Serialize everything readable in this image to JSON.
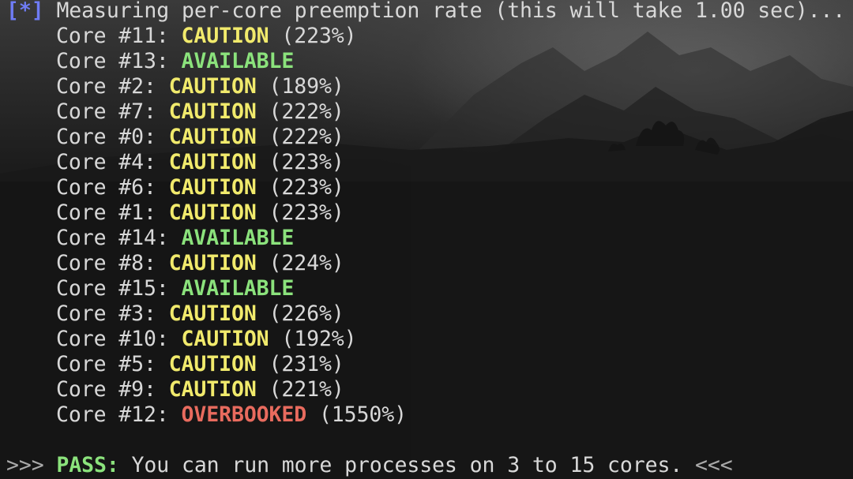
{
  "header": {
    "marker": "[*]",
    "message": "Measuring per-core preemption rate (this will take 1.00 sec)..."
  },
  "cores": [
    {
      "label": "Core #11: ",
      "status": "CAUTION",
      "rate": " (223%)",
      "kind": "caution"
    },
    {
      "label": "Core #13: ",
      "status": "AVAILABLE",
      "rate": "",
      "kind": "available"
    },
    {
      "label": "Core #2: ",
      "status": "CAUTION",
      "rate": " (189%)",
      "kind": "caution"
    },
    {
      "label": "Core #7: ",
      "status": "CAUTION",
      "rate": " (222%)",
      "kind": "caution"
    },
    {
      "label": "Core #0: ",
      "status": "CAUTION",
      "rate": " (222%)",
      "kind": "caution"
    },
    {
      "label": "Core #4: ",
      "status": "CAUTION",
      "rate": " (223%)",
      "kind": "caution"
    },
    {
      "label": "Core #6: ",
      "status": "CAUTION",
      "rate": " (223%)",
      "kind": "caution"
    },
    {
      "label": "Core #1: ",
      "status": "CAUTION",
      "rate": " (223%)",
      "kind": "caution"
    },
    {
      "label": "Core #14: ",
      "status": "AVAILABLE",
      "rate": "",
      "kind": "available"
    },
    {
      "label": "Core #8: ",
      "status": "CAUTION",
      "rate": " (224%)",
      "kind": "caution"
    },
    {
      "label": "Core #15: ",
      "status": "AVAILABLE",
      "rate": "",
      "kind": "available"
    },
    {
      "label": "Core #3: ",
      "status": "CAUTION",
      "rate": " (226%)",
      "kind": "caution"
    },
    {
      "label": "Core #10: ",
      "status": "CAUTION",
      "rate": " (192%)",
      "kind": "caution"
    },
    {
      "label": "Core #5: ",
      "status": "CAUTION",
      "rate": " (231%)",
      "kind": "caution"
    },
    {
      "label": "Core #9: ",
      "status": "CAUTION",
      "rate": " (221%)",
      "kind": "caution"
    },
    {
      "label": "Core #12: ",
      "status": "OVERBOOKED",
      "rate": " (1550%)",
      "kind": "overbooked"
    }
  ],
  "result": {
    "prefix": ">>> ",
    "label": "PASS:",
    "message": " You can run more processes on 3 to 15 cores. ",
    "suffix": "<<<"
  },
  "colors": {
    "marker": "#6f7cf5",
    "caution": "#f1ea6c",
    "available": "#8be27c",
    "overbooked": "#e86b5e",
    "text": "#d8d8d8"
  }
}
